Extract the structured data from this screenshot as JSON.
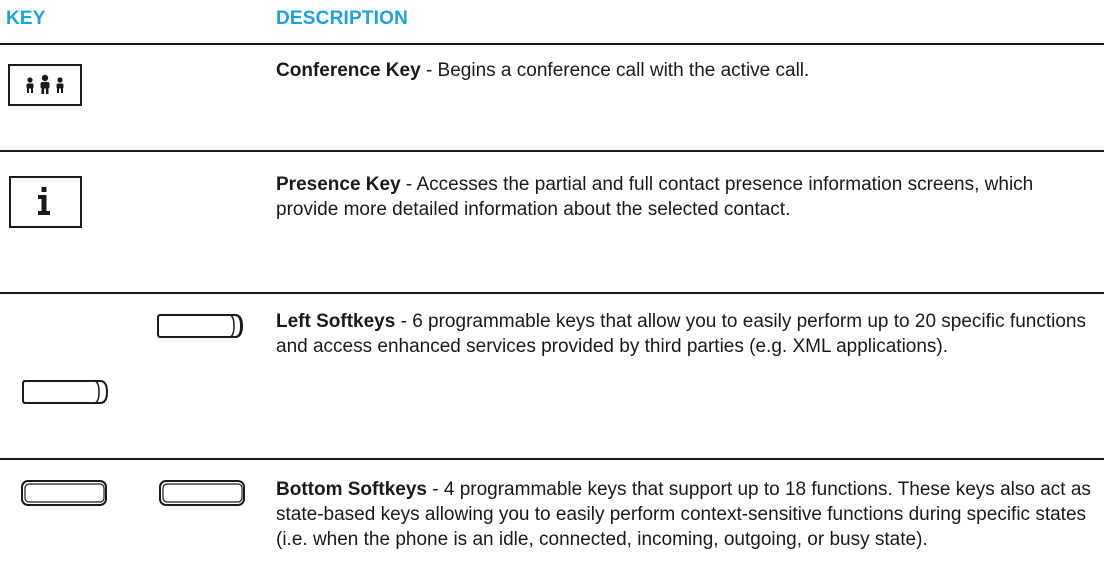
{
  "header": {
    "key": "KEY",
    "description": "DESCRIPTION"
  },
  "rows": [
    {
      "icon": "conference-people-icon",
      "title": "Conference Key",
      "text": " - Begins a conference call with the active call."
    },
    {
      "icon": "info-i-icon",
      "title": "Presence Key",
      "text": " - Accesses the partial and full contact presence information screens, which provide more detailed information about the selected contact."
    },
    {
      "icon": "softkey-icon",
      "title": "Left Softkeys",
      "text": " - 6 programmable keys that allow you to easily perform up to 20 specific functions and access enhanced services provided by third parties (e.g. XML applications)."
    },
    {
      "icon": "softkey-icon",
      "title": "Bottom Softkeys",
      "text": " - 4 programmable keys that support up to 18 functions. These keys also act as state-based keys allowing you to easily perform context-sensitive functions during specific states (i.e. when the phone is an idle, connected, incoming, outgoing, or busy state)."
    }
  ],
  "colors": {
    "header": "#1da1e2",
    "text": "#1a1a1a"
  }
}
